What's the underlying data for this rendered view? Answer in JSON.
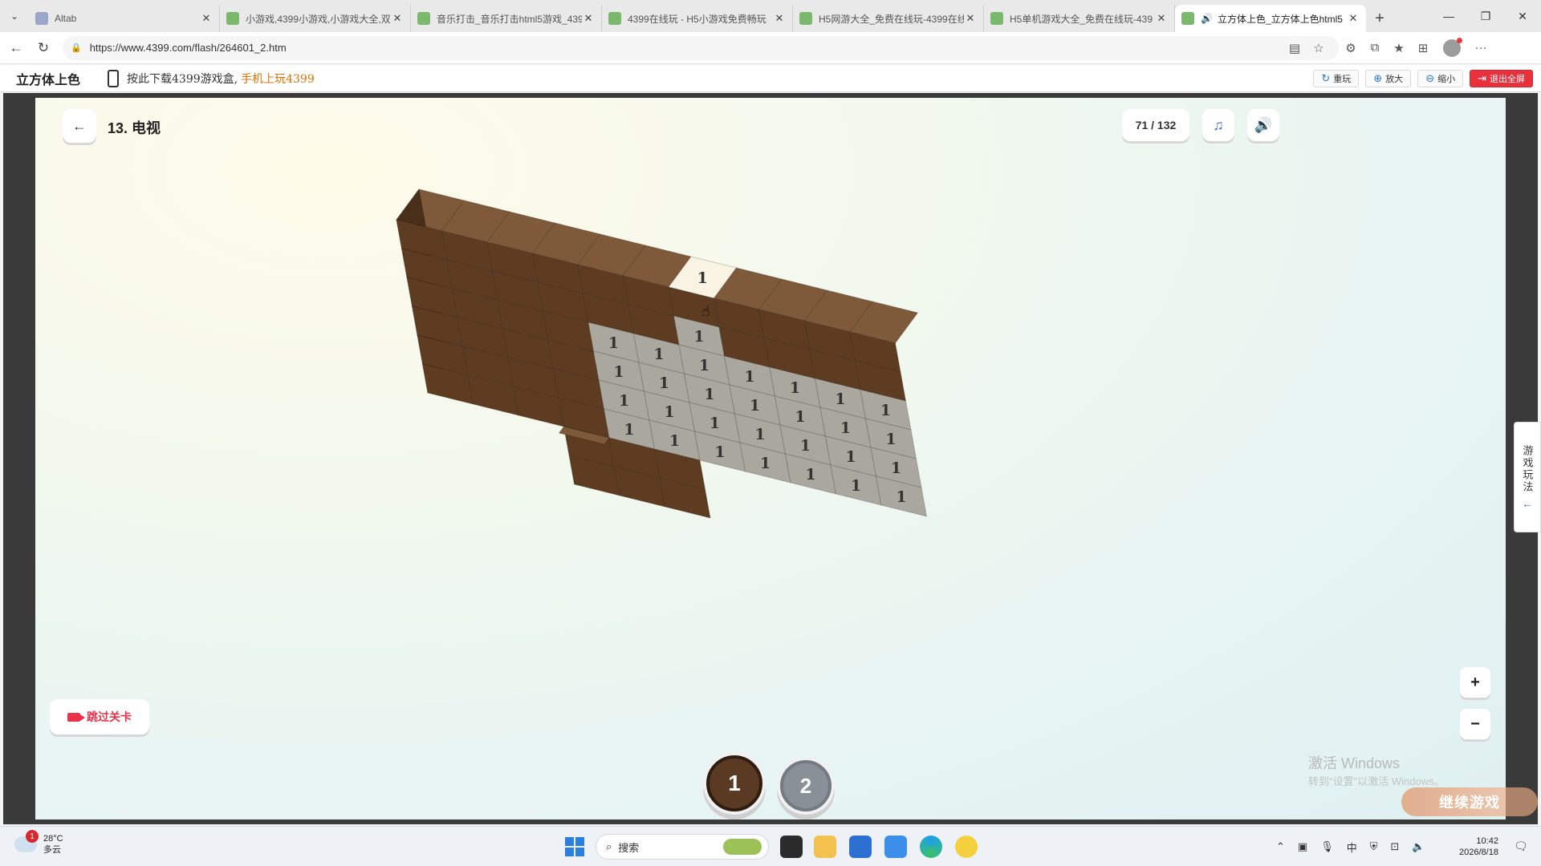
{
  "browser": {
    "tabs": [
      {
        "title": "Altab",
        "active": false
      },
      {
        "title": "小游戏,4399小游戏,小游戏大全,双",
        "active": false
      },
      {
        "title": "音乐打击_音乐打击html5游戏_439",
        "active": false
      },
      {
        "title": "4399在线玩 - H5小游戏免费畅玩",
        "active": false
      },
      {
        "title": "H5网游大全_免费在线玩-4399在线",
        "active": false
      },
      {
        "title": "H5单机游戏大全_免费在线玩-439",
        "active": false
      },
      {
        "title": "立方体上色_立方体上色html5",
        "active": true
      }
    ],
    "url": "https://www.4399.com/flash/264601_2.htm"
  },
  "site": {
    "title": "立方体上色",
    "download_text": "按此下载4399游戏盒,",
    "download_link": "手机上玩4399",
    "actions": {
      "replay": "重玩",
      "zoom_in": "放大",
      "zoom_out": "缩小",
      "exit_fullscreen": "退出全屏"
    },
    "side_tab": "游戏玩法"
  },
  "game": {
    "level_title": "13. 电视",
    "progress": "71 / 132",
    "skip_label": "跳过关卡",
    "zoom_in": "+",
    "zoom_out": "−",
    "cell_number": "1",
    "colors": [
      {
        "label": "1",
        "hex": "#5a3a22",
        "selected": true
      },
      {
        "label": "2",
        "hex": "#8a9097",
        "selected": false
      }
    ],
    "palette": {
      "brown_top": "#7e5a3b",
      "brown_front": "#5e3c22",
      "brown_side": "#4a2f1b",
      "gray_face": "#aaa79f",
      "highlight": "#f8f3e3"
    }
  },
  "watermark": {
    "line1": "激活 Windows",
    "line2": "转到\"设置\"以激活 Windows。"
  },
  "continue_label": "继续游戏",
  "taskbar": {
    "weather_temp": "28°C",
    "weather_desc": "多云",
    "weather_badge": "1",
    "search_placeholder": "搜索",
    "time": "10:42",
    "date": "2026/8/18"
  }
}
